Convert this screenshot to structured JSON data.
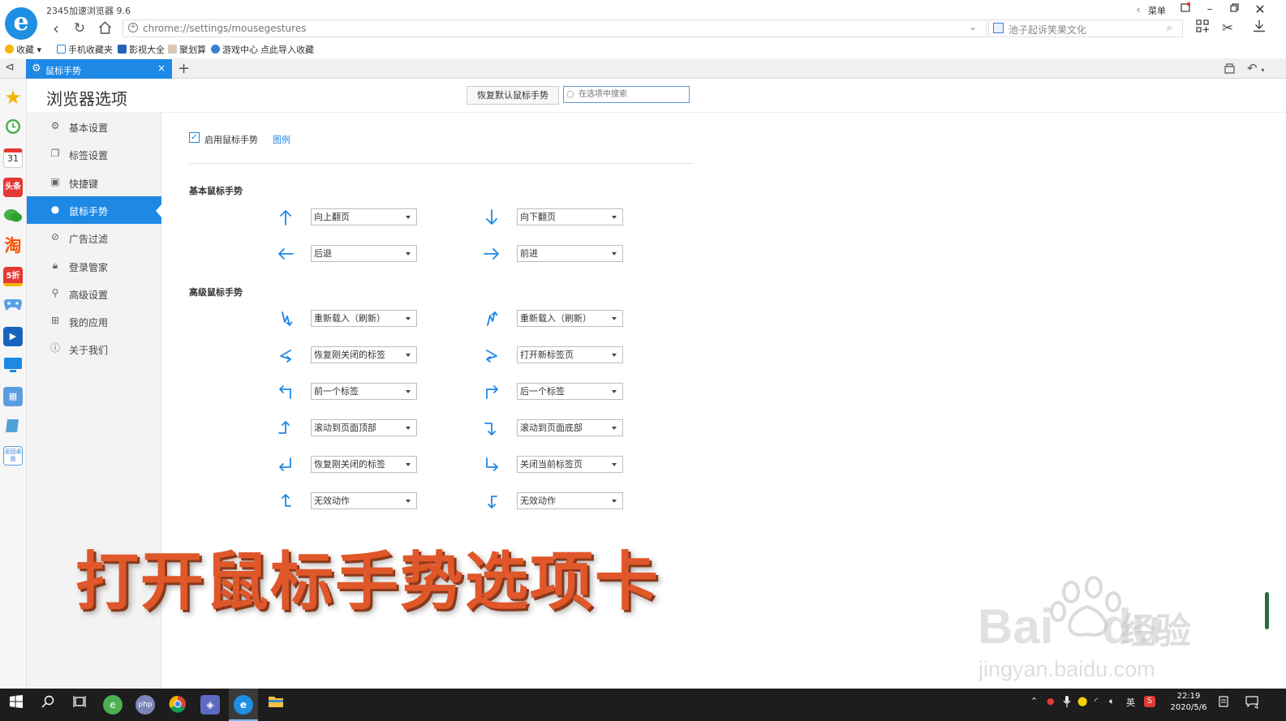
{
  "window": {
    "app_title": "2345加速浏览器 9.6",
    "menu_label": "菜单"
  },
  "nav": {
    "url": "chrome://settings/mousegestures",
    "search_text": "池子起诉笑果文化"
  },
  "bookmarks": [
    "收藏",
    "手机收藏夹",
    "影视大全",
    "聚划算",
    "游戏中心",
    "点此导入收藏"
  ],
  "tab": {
    "title": "鼠标手势",
    "new_tab": "+"
  },
  "quickbar": {
    "calendar": "31",
    "toutiao": "头条",
    "taobao": "淘",
    "deal": "5折",
    "back_desktop": "返回桌面"
  },
  "settings": {
    "title": "浏览器选项",
    "restore_button": "恢复默认鼠标手势",
    "search_placeholder": "在选项中搜索",
    "nav": [
      {
        "label": "基本设置",
        "icon": "gear-icon"
      },
      {
        "label": "标签设置",
        "icon": "tab-icon"
      },
      {
        "label": "快捷键",
        "icon": "keyboard-icon"
      },
      {
        "label": "鼠标手势",
        "icon": "mouse-icon"
      },
      {
        "label": "广告过滤",
        "icon": "block-icon"
      },
      {
        "label": "登录管家",
        "icon": "lock-icon"
      },
      {
        "label": "高级设置",
        "icon": "wrench-icon"
      },
      {
        "label": "我的应用",
        "icon": "apps-icon"
      },
      {
        "label": "关于我们",
        "icon": "info-icon"
      }
    ],
    "active_nav": "鼠标手势",
    "enable_label": "启用鼠标手势",
    "enable_checked": true,
    "legend_link": "图例",
    "basic_title": "基本鼠标手势",
    "advanced_title": "高级鼠标手势",
    "basic_rows": [
      {
        "left_action": "向上翻页",
        "left_icon": "arrow-up-icon",
        "right_action": "向下翻页",
        "right_icon": "arrow-down-icon"
      },
      {
        "left_action": "后退",
        "left_icon": "arrow-left-icon",
        "right_action": "前进",
        "right_icon": "arrow-right-icon"
      }
    ],
    "advanced_rows": [
      {
        "left_action": "重新载入（刷新）",
        "left_icon": "gesture-down-up-down-icon",
        "right_action": "重新载入（刷新）",
        "right_icon": "gesture-up-down-up-icon"
      },
      {
        "left_action": "恢复刚关闭的标签",
        "left_icon": "gesture-left-right-icon",
        "right_action": "打开新标签页",
        "right_icon": "gesture-right-left-icon"
      },
      {
        "left_action": "前一个标签",
        "left_icon": "gesture-up-left-icon",
        "right_action": "后一个标签",
        "right_icon": "gesture-up-right-icon"
      },
      {
        "left_action": "滚动到页面顶部",
        "left_icon": "gesture-right-up-icon",
        "right_action": "滚动到页面底部",
        "right_icon": "gesture-right-down-icon"
      },
      {
        "left_action": "恢复刚关闭的标签",
        "left_icon": "gesture-down-left-icon",
        "right_action": "关闭当前标签页",
        "right_icon": "gesture-down-right-icon"
      },
      {
        "left_action": "无效动作",
        "left_icon": "gesture-left-up-icon",
        "right_action": "无效动作",
        "right_icon": "gesture-left-down-icon"
      }
    ]
  },
  "overlay_title": "打开鼠标手势选项卡",
  "watermark": {
    "brand": "Bai",
    "brand2": "du",
    "cn": "经验",
    "url": "jingyan.baidu.com"
  },
  "taskbar": {
    "ime": "英",
    "time": "22:19",
    "date": "2020/5/6",
    "notif_count": "4",
    "php_label": "php"
  },
  "colors": {
    "accent": "#1e88e5",
    "overlay_text": "#e0572a",
    "taskbar": "#1d1d1d"
  }
}
